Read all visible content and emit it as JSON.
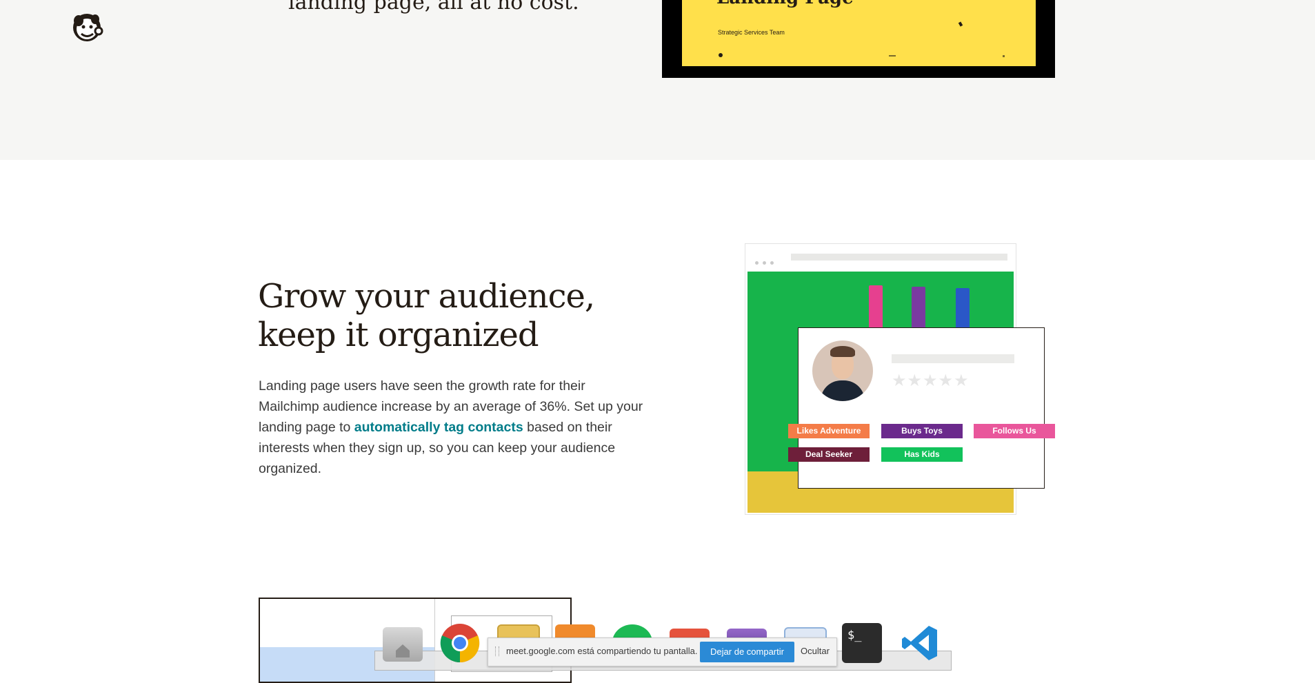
{
  "top": {
    "heading": "landing page, all at no cost.",
    "preview": {
      "title": "Landing Page",
      "subtitle": "Strategic Services Team"
    }
  },
  "section": {
    "heading_line1": "Grow your audience,",
    "heading_line2": "keep it organized",
    "body_before": "Landing page users have seen the growth rate for their Mailchimp audience increase by an average of 36%. Set up your landing page to ",
    "body_link": "automatically tag contacts",
    "body_after": " based on their interests when they sign up, so you can keep your audience organized."
  },
  "illustration": {
    "stars": "★★★★★",
    "tags": [
      {
        "label": "Likes Adventure",
        "color": "#f47c48"
      },
      {
        "label": "Buys Toys",
        "color": "#6b2a8c"
      },
      {
        "label": "Follows Us",
        "color": "#e9569b"
      },
      {
        "label": "Deal Seeker",
        "color": "#6e1f3a"
      },
      {
        "label": "Has Kids",
        "color": "#12c25b"
      }
    ]
  },
  "share_bar": {
    "message": "meet.google.com está compartiendo tu pantalla.",
    "stop_label": "Dejar de compartir",
    "hide_label": "Ocultar"
  },
  "dock": {
    "icons": [
      "home-folder-icon",
      "chrome-icon",
      "mail-icon",
      "presentation-icon",
      "spotify-icon",
      "app-icon",
      "image-icon",
      "screenshot-icon",
      "terminal-icon",
      "vscode-icon"
    ],
    "terminal_glyph": "$_"
  },
  "colors": {
    "link": "#007c89",
    "top_band": "#f6f6f4",
    "preview_yellow": "#ffe04b",
    "share_button": "#2b8ad6"
  }
}
